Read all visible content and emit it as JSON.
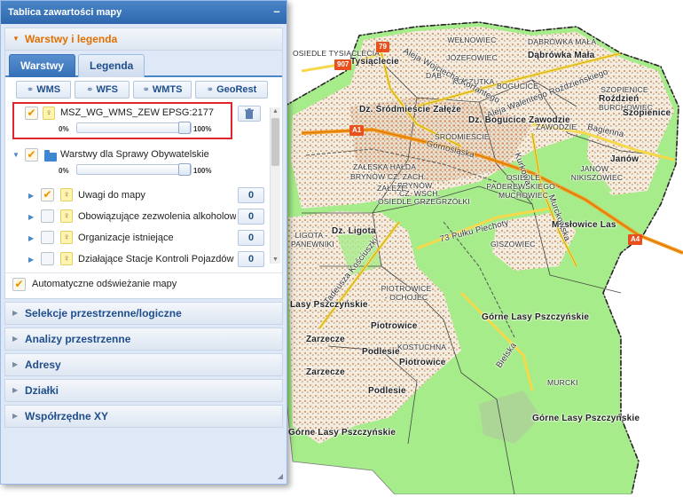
{
  "panel": {
    "title": "Tablica zawartości mapy",
    "collapse_symbol": "–"
  },
  "legend_section": {
    "title": "Warstwy i legenda",
    "tabs": [
      {
        "label": "Warstwy",
        "active": true
      },
      {
        "label": "Legenda",
        "active": false
      }
    ],
    "sources": [
      "WMS",
      "WFS",
      "WMTS",
      "GeoRest"
    ],
    "added_layer": {
      "name": "MSZ_WG_WMS_ZEW EPSG:2177",
      "checked": true,
      "opacity_min_label": "0%",
      "opacity_max_label": "100%",
      "opacity": 1.0
    },
    "group": {
      "name": "Warstwy dla Sprawy Obywatelskie",
      "checked": true,
      "opacity_min_label": "0%",
      "opacity_max_label": "100%",
      "opacity": 1.0
    },
    "layers": [
      {
        "name": "Uwagi do mapy",
        "checked": true,
        "count": "0"
      },
      {
        "name": "Obowiązujące zezwolenia alkoholow",
        "checked": false,
        "count": "0"
      },
      {
        "name": "Organizacje istniejące",
        "checked": false,
        "count": "0"
      },
      {
        "name": "Działające Stacje Kontroli Pojazdów",
        "checked": false,
        "count": "0"
      }
    ],
    "auto_refresh_label": "Automatyczne odświeżanie mapy",
    "auto_refresh_checked": true
  },
  "sections": [
    "Selekcje przestrzenne/logiczne",
    "Analizy przestrzenne",
    "Adresy",
    "Działki",
    "Współrzędne XY"
  ],
  "icons": {
    "collapse": "minus-icon",
    "expand_arrow": "triangle-right-icon",
    "active_arrow": "triangle-down-icon",
    "source_link": "link-icon",
    "checkbox_check": "checkmark-icon",
    "visibility": "lightbulb-icon",
    "folder": "folder-icon",
    "delete": "trash-icon"
  },
  "colors": {
    "header_blue": "#2e67ad",
    "accent_orange": "#e07000",
    "highlight_red": "#e0242c",
    "forest_green": "#a6ec8a",
    "road_yellow": "#f5d94a",
    "motorway_orange": "#f59a1e"
  },
  "map": {
    "labels": [
      "OSIEDLE TYSIĄCLECIA",
      "Tysiąclecie",
      "WEŁNOWIEC - JÓZEFOWIEC",
      "DĄBRÓWKA MAŁA",
      "Dąbrówka Mała",
      "DĄB",
      "KOSZUTKA",
      "BOGUCICE",
      "SZOPIENICE - BURCHOWIEC",
      "Roździeń",
      "Szopienice",
      "Dz. Śródmieście Załęże",
      "Dz. Bogucice Zawodzie",
      "ZAWODZIE",
      "ŚRÓDMIEŚCIE",
      "Janów",
      "JANÓW - NIKISZOWIEC",
      "ZAŁĘSKA HAŁDA",
      "BRYNÓW CZ. ZACH.",
      "BRYNÓW",
      "CZ. WSCH.",
      "ZAŁĘŻE",
      "OSIEDLE PADEREWSKIEGO - MUCHOWIEC",
      "OSIEDLE GRZEGRZÓŁKI",
      "Dz. Ligota",
      "LIGOTA - PANEWNIKI",
      "Mysłowice Las",
      "GISZOWIEC",
      "PIOTROWICE - OCHOJEC",
      "Lasy Pszczyńskie",
      "Górne Lasy Pszczyńskie",
      "Piotrowice",
      "Zarzecze",
      "KOSTUCHNA",
      "Podlesie",
      "MURCKI"
    ],
    "roads": [
      "Aleja Wojciecha Korfantego",
      "Aleja Walentego Roździeńskiego",
      "Bagienna",
      "Górnośląska",
      "73 Pułku Piechoty",
      "Tadeusza Kościuszki",
      "Bielska",
      "Kurkowa",
      "Murckowska"
    ],
    "shields": [
      "79",
      "907",
      "A1",
      "A4"
    ]
  }
}
